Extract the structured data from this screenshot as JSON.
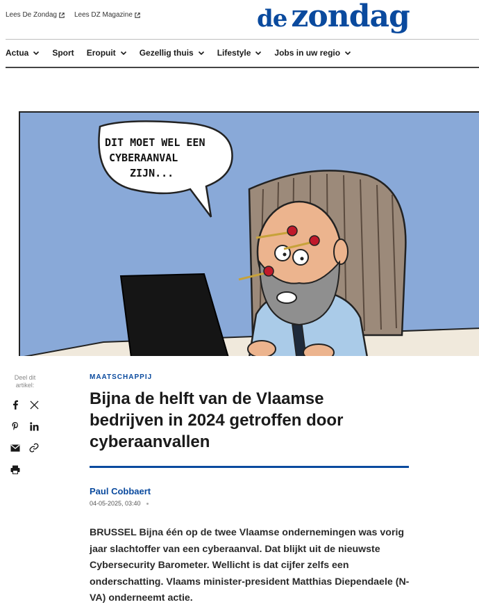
{
  "header": {
    "links": [
      {
        "label": "Lees De Zondag"
      },
      {
        "label": "Lees DZ Magazine"
      }
    ],
    "logo_small": "de",
    "logo_big": "zondag"
  },
  "nav": {
    "items": [
      {
        "label": "Actua",
        "has_dropdown": true
      },
      {
        "label": "Sport",
        "has_dropdown": false
      },
      {
        "label": "Eropuit",
        "has_dropdown": true
      },
      {
        "label": "Gezellig thuis",
        "has_dropdown": true
      },
      {
        "label": "Lifestyle",
        "has_dropdown": true
      },
      {
        "label": "Jobs in uw regio",
        "has_dropdown": true
      }
    ]
  },
  "cartoon": {
    "speech_lines": [
      "DIT MOET WEL EEN",
      "CYBERAANVAL",
      "ZIJN..."
    ]
  },
  "share": {
    "label_line1": "Deel dit",
    "label_line2": "artikel:",
    "icons": [
      "facebook-icon",
      "x-icon",
      "pinterest-icon",
      "linkedin-icon",
      "mail-icon",
      "link-icon",
      "print-icon"
    ]
  },
  "article": {
    "category": "MAATSCHAPPIJ",
    "headline": "Bijna de helft van de Vlaamse bedrijven in 2024 getroffen door cyberaanvallen",
    "author": "Paul Cobbaert",
    "date": "04-05-2025, 03:40",
    "lead": "BRUSSEL Bijna één op de twee Vlaamse ondernemingen was vorig jaar slachtoffer van een cyberaanval. Dat blijkt uit de nieuwste Cybersecurity Barometer. Wellicht is dat cijfer zelfs een onderschatting. Vlaams minister-president Matthias Diependaele (N-VA) onderneemt actie."
  },
  "colors": {
    "brand_blue": "#0a4a9e",
    "cartoon_bg": "#89a9d8"
  }
}
